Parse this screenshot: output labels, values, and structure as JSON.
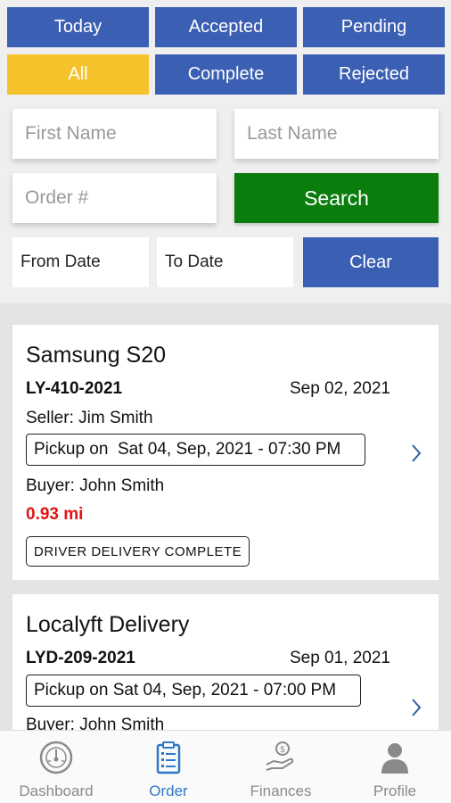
{
  "tabs": [
    {
      "label": "Today",
      "active": false
    },
    {
      "label": "Accepted",
      "active": false
    },
    {
      "label": "Pending",
      "active": false
    },
    {
      "label": "All",
      "active": true
    },
    {
      "label": "Complete",
      "active": false
    },
    {
      "label": "Rejected",
      "active": false
    }
  ],
  "filters": {
    "first_name_placeholder": "First Name",
    "last_name_placeholder": "Last Name",
    "order_placeholder": "Order #",
    "search_label": "Search",
    "from_date_label": "From Date",
    "to_date_label": "To Date",
    "clear_label": "Clear"
  },
  "orders": [
    {
      "title": "Samsung S20",
      "order_id": "LY-410-2021",
      "date": "Sep 02, 2021",
      "seller": "Seller: Jim Smith",
      "pickup": "Pickup on  Sat 04, Sep, 2021 - 07:30 PM",
      "buyer": "Buyer: John Smith",
      "distance": "0.93 mi",
      "status": "DRIVER DELIVERY COMPLETE"
    },
    {
      "title": "Localyft Delivery",
      "order_id": "LYD-209-2021",
      "date": "Sep 01, 2021",
      "pickup": "Pickup on Sat 04, Sep, 2021 - 07:00 PM",
      "buyer": "Buyer: John Smith"
    }
  ],
  "nav": [
    {
      "label": "Dashboard",
      "icon": "gauge-icon",
      "active": false
    },
    {
      "label": "Order",
      "icon": "clipboard-icon",
      "active": true
    },
    {
      "label": "Finances",
      "icon": "money-hand-icon",
      "active": false
    },
    {
      "label": "Profile",
      "icon": "person-icon",
      "active": false
    }
  ],
  "colors": {
    "tab_blue": "#3b5fb3",
    "tab_active": "#f6c22c",
    "search_green": "#0a7d0d",
    "distance_red": "#e01515",
    "nav_active": "#2f78c8"
  }
}
